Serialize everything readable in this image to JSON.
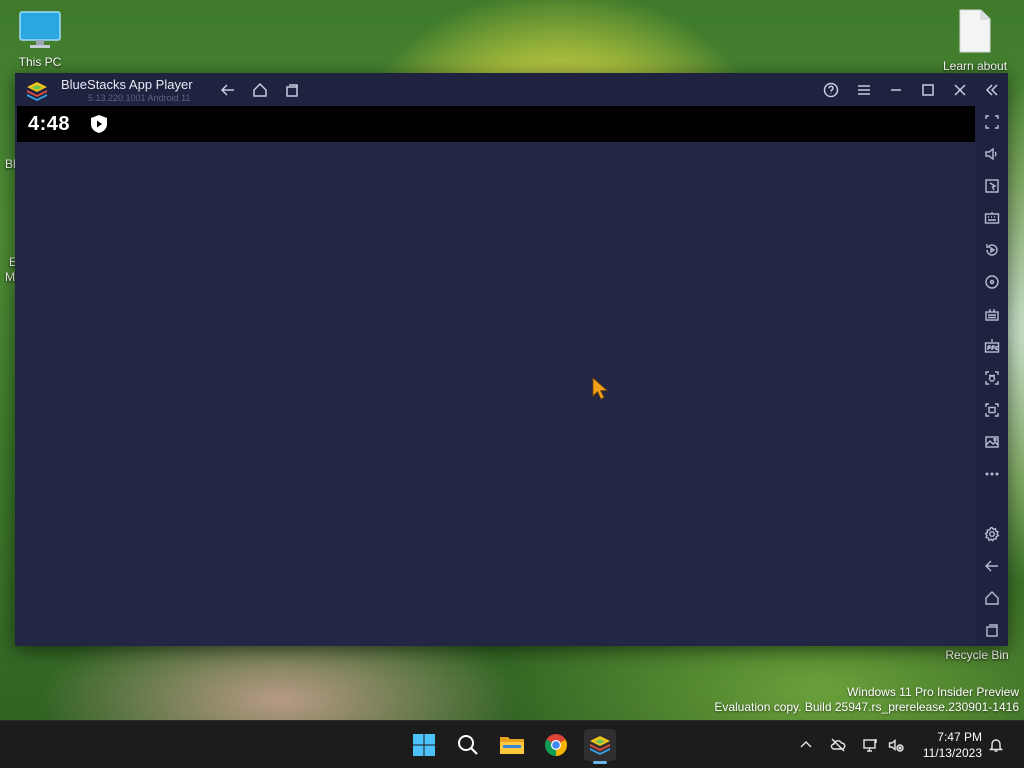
{
  "desktop": {
    "icons": [
      {
        "label": "This PC"
      },
      {
        "label": "Learn about"
      },
      {
        "label": "Recycle Bin"
      }
    ],
    "side_fragments": [
      "Bl",
      "E",
      "M"
    ]
  },
  "bluestacks": {
    "title": "BlueStacks App Player",
    "version": "5.13.220.1001 Android 11",
    "android_time": "4:48",
    "rail_items": [
      "fullscreen-icon",
      "volume-icon",
      "pointer-icon",
      "keyboard-icon",
      "replay-icon",
      "rotate-icon",
      "macro-icon",
      "apk-icon",
      "screenshot-icon",
      "screen-record-icon",
      "media-folder-icon",
      "more-icon",
      "settings-icon",
      "back-icon",
      "home-icon",
      "recent-apps-icon"
    ]
  },
  "watermark": {
    "line1": "Windows 11 Pro Insider Preview",
    "line2": "Evaluation copy. Build 25947.rs_prerelease.230901-1416"
  },
  "taskbar": {
    "time": "7:47 PM",
    "date": "11/13/2023",
    "accent": "#6fb6e8"
  }
}
